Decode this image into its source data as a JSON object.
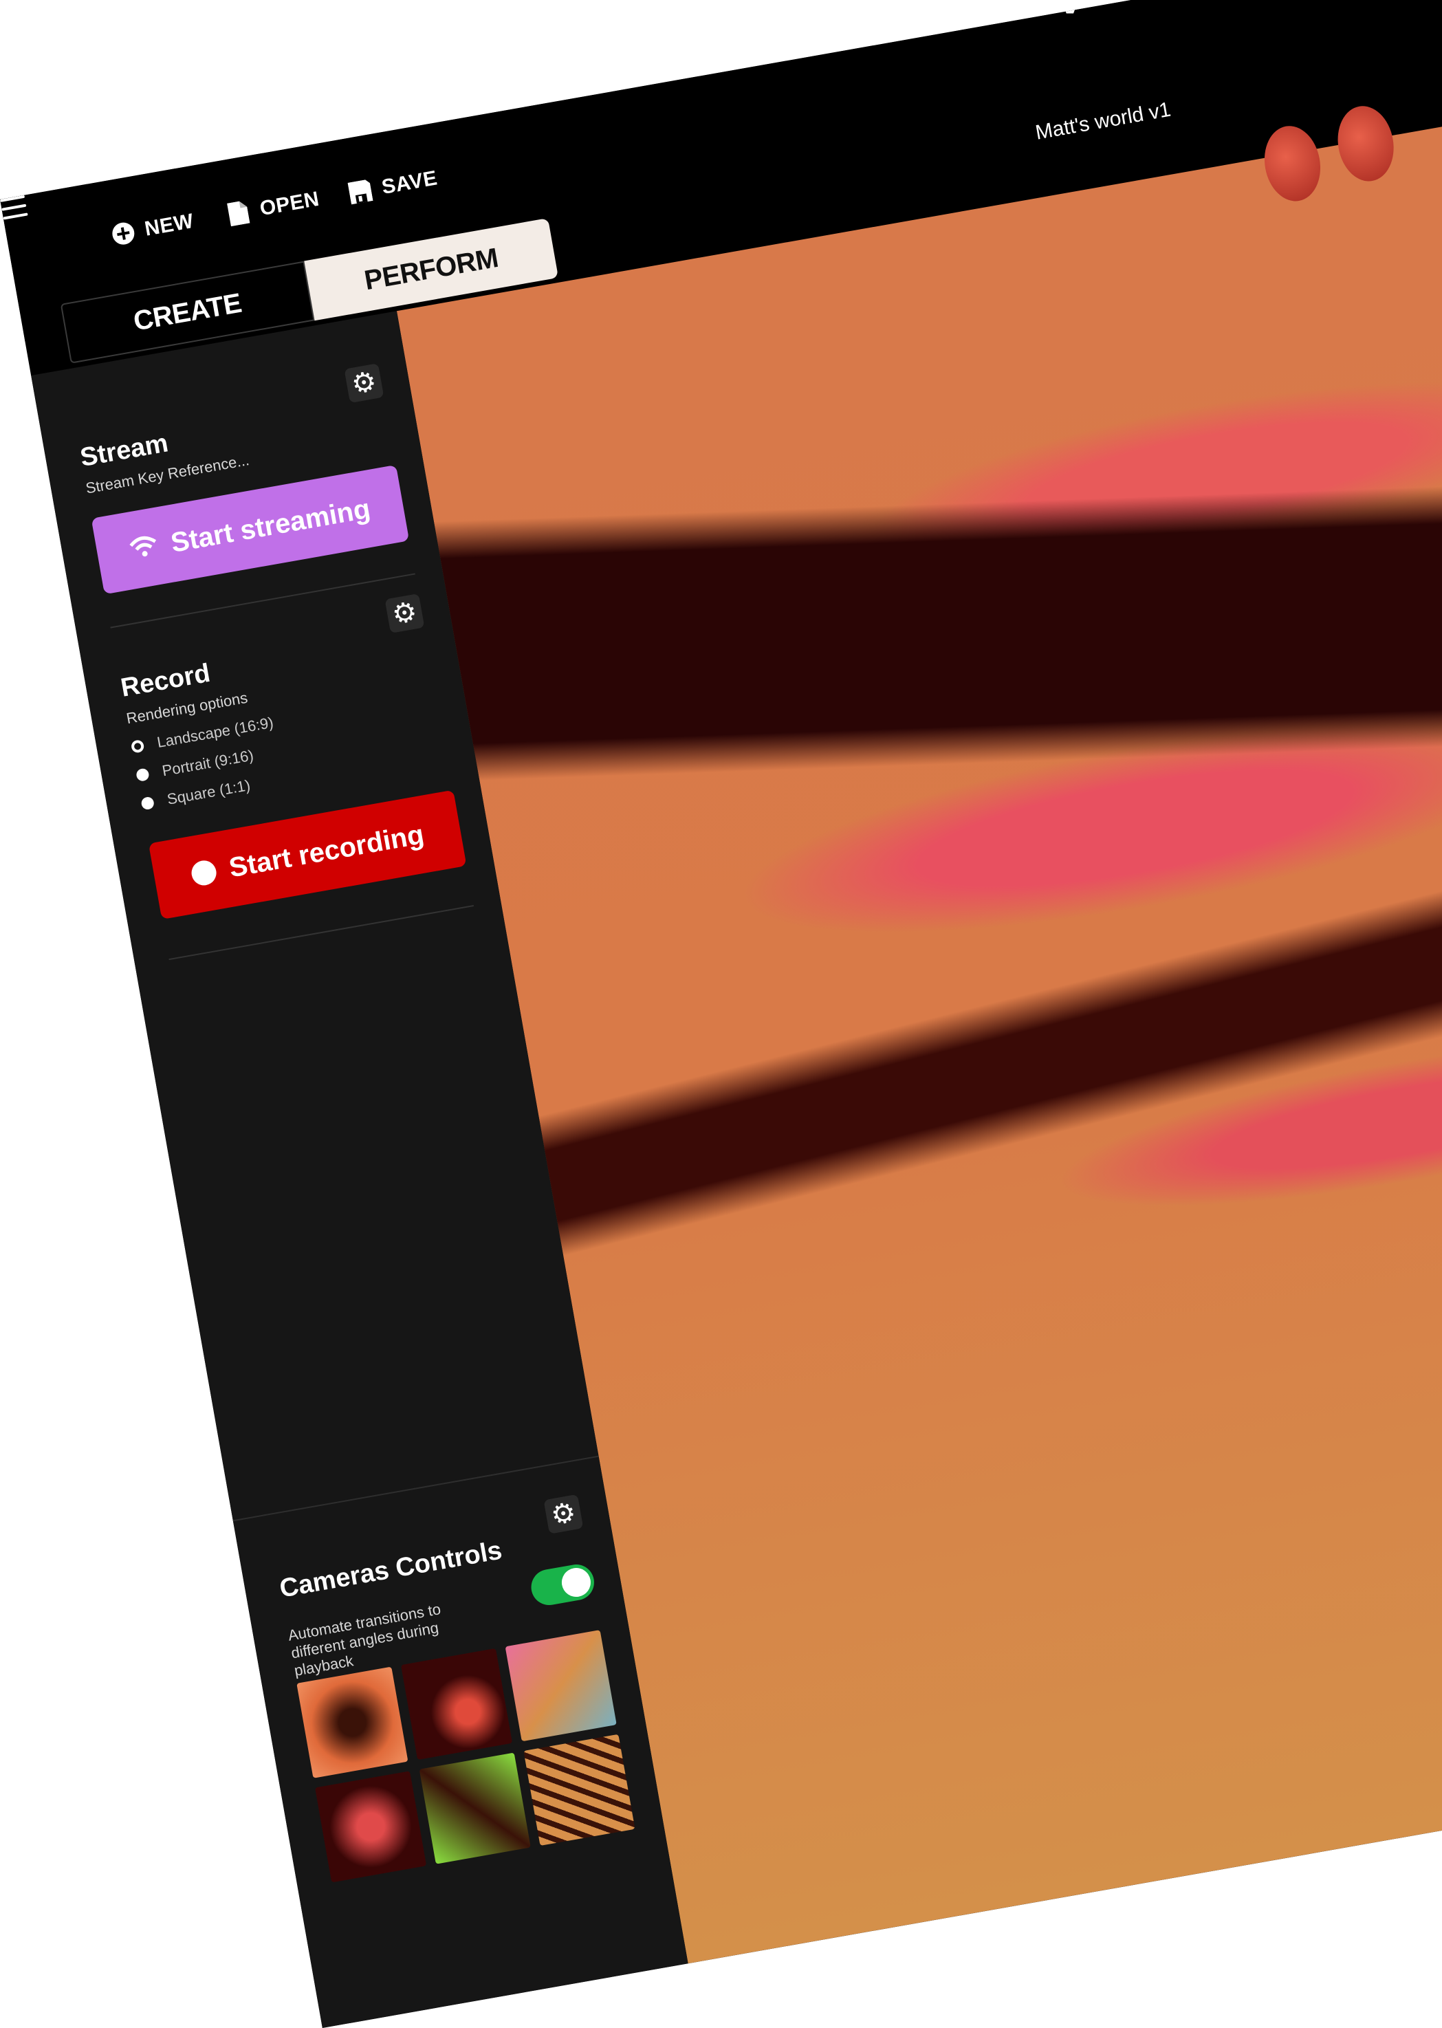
{
  "topbar": {
    "new_label": "NEW",
    "open_label": "OPEN",
    "save_label": "SAVE",
    "logo": "V",
    "project_title": "Matt's world v1"
  },
  "tabs": [
    {
      "label": "CREATE",
      "active": false
    },
    {
      "label": "PERFORM",
      "active": true
    }
  ],
  "stream": {
    "title": "Stream",
    "subtitle": "Stream Key Reference...",
    "button_label": "Start streaming",
    "button_color": "#c070e8"
  },
  "record": {
    "title": "Record",
    "options_label": "Rendering options",
    "options": [
      {
        "label": "Landscape (16:9)",
        "selected": true
      },
      {
        "label": "Portrait (9:16)",
        "selected": false
      },
      {
        "label": "Square (1:1)",
        "selected": false
      }
    ],
    "button_label": "Start recording",
    "button_color": "#d00000"
  },
  "cameras": {
    "title": "Cameras Controls",
    "description": "Automate transitions to different angles during playback",
    "toggle_on": true,
    "toggle_color": "#19b34a",
    "thumbnail_count": 6
  },
  "icons": {
    "menu": "menu-icon",
    "new": "plus-circle-icon",
    "open": "file-icon",
    "save": "floppy-icon",
    "gear": "gear-icon",
    "wifi": "wifi-icon",
    "record": "record-dot-icon"
  }
}
